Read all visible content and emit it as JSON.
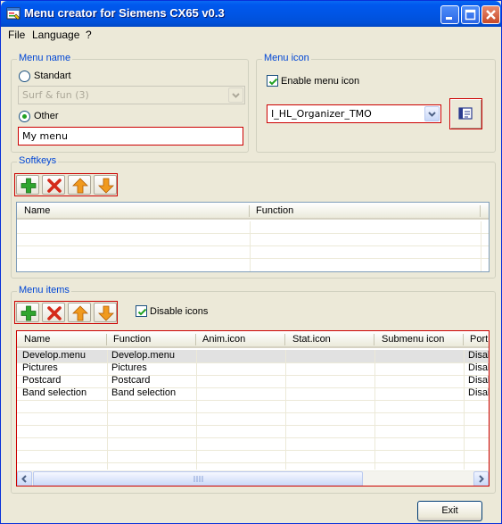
{
  "window": {
    "title": "Menu creator for Siemens CX65 v0.3"
  },
  "menubar": {
    "items": [
      "File",
      "Language",
      "?"
    ]
  },
  "menu_name": {
    "legend": "Menu name",
    "standart_label": "Standart",
    "standart_combo_value": "Surf & fun (3)",
    "other_label": "Other",
    "other_selected": true,
    "name_input_value": "My menu"
  },
  "menu_icon": {
    "legend": "Menu icon",
    "enable_label": "Enable menu icon",
    "enable_checked": true,
    "icon_combo_value": "I_HL_Organizer_TMO"
  },
  "softkeys": {
    "legend": "Softkeys",
    "columns": [
      "Name",
      "Function"
    ]
  },
  "menu_items": {
    "legend": "Menu items",
    "disable_icons_label": "Disable icons",
    "disable_icons_checked": true,
    "columns": [
      "Name",
      "Function",
      "Anim.icon",
      "Stat.icon",
      "Submenu icon",
      "Port"
    ],
    "rows": [
      [
        "Develop.menu",
        "Develop.menu",
        "",
        "",
        "",
        "Disal"
      ],
      [
        "Pictures",
        "Pictures",
        "",
        "",
        "",
        "Disal"
      ],
      [
        "Postcard",
        "Postcard",
        "",
        "",
        "",
        "Disal"
      ],
      [
        "Band selection",
        "Band selection",
        "",
        "",
        "",
        "Disal"
      ]
    ]
  },
  "footer": {
    "exit_label": "Exit"
  },
  "colors": {
    "titlebar": "#0055e5",
    "group_label": "#0046d5",
    "highlight_border": "#cc0000",
    "add_icon": "#2fa52f",
    "delete_icon": "#d42a1a",
    "arrow_icon": "#f09a1e"
  }
}
